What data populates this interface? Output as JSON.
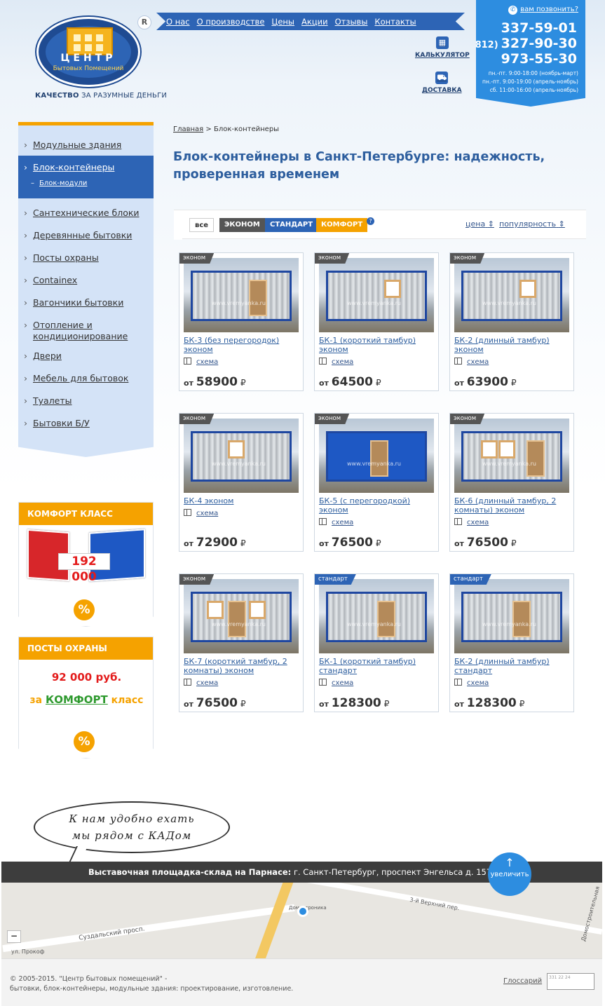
{
  "header": {
    "logo_title": "ЦЕНТР",
    "logo_subtitle": "Бытовых Помещений",
    "registered": "R",
    "tagline_bold": "КАЧЕСТВО",
    "tagline_rest": " ЗА РАЗУМНЫЕ ДЕНЬГИ",
    "nav": [
      "О нас",
      "О производстве",
      "Цены",
      "Акции",
      "Отзывы",
      "Контакты"
    ],
    "calculator_label": "КАЛЬКУЛЯТОР",
    "delivery_label": "ДОСТАВКА",
    "callback_label": "вам позвонить?",
    "phone_1": "337-59-01",
    "phone_code": "(812)",
    "phone_2": "327-90-30",
    "phone_3": "973-55-30",
    "hours_1": "пн.-пт. 9:00-18:00 (ноябрь-март)",
    "hours_2": "пн.-пт. 9:00-19:00 (апрель-ноябрь)",
    "hours_3": "сб. 11:00-16:00 (апрель-ноябрь)"
  },
  "sidebar": {
    "items": [
      "Модульные здания",
      "Сантехнические блоки",
      "Деревянные бытовки",
      "Посты охраны",
      "Containex",
      "Вагончики бытовки",
      "Отопление и кондиционирование",
      "Двери",
      "Мебель для бытовок",
      "Туалеты",
      "Бытовки Б/У"
    ],
    "active_item": "Блок-контейнеры",
    "active_sub": "Блок-модули"
  },
  "promos": {
    "comfort_title": "КОМФОРТ КЛАСС",
    "comfort_price": "192 000",
    "posts_title": "ПОСТЫ ОХРАНЫ",
    "posts_price": "92 000 руб.",
    "posts_prefix": "за",
    "posts_highlight": "КОМФОРТ",
    "posts_suffix": "класс",
    "percent": "%"
  },
  "main": {
    "breadcrumb_home": "Главная",
    "breadcrumb_sep": " > ",
    "breadcrumb_current": "Блок-контейнеры",
    "title": "Блок-контейнеры в Санкт-Петербурге: надежность, проверенная временем",
    "filters": {
      "all": "все",
      "eco": "ЭКОНОМ",
      "std": "СТАНДАРТ",
      "com": "КОМФОРТ",
      "help": "?",
      "sort_price": "цена",
      "sort_pop": "популярность"
    }
  },
  "products": [
    {
      "tag": "эконом",
      "tag_type": "eco",
      "name": "БК-3 (без перегородок) эконом",
      "scheme": "схема",
      "price_prefix": "от",
      "price": "58900",
      "currency": "₽"
    },
    {
      "tag": "эконом",
      "tag_type": "eco",
      "name": "БК-1 (короткий тамбур) эконом",
      "scheme": "схема",
      "price_prefix": "от",
      "price": "64500",
      "currency": "₽"
    },
    {
      "tag": "эконом",
      "tag_type": "eco",
      "name": "БК-2 (длинный тамбур) эконом",
      "scheme": "схема",
      "price_prefix": "от",
      "price": "63900",
      "currency": "₽"
    },
    {
      "tag": "эконом",
      "tag_type": "eco",
      "name": "БК-4 эконом",
      "scheme": "схема",
      "price_prefix": "от",
      "price": "72900",
      "currency": "₽"
    },
    {
      "tag": "эконом",
      "tag_type": "eco",
      "name": "БК-5 (с перегородкой) эконом",
      "scheme": "схема",
      "price_prefix": "от",
      "price": "76500",
      "currency": "₽"
    },
    {
      "tag": "эконом",
      "tag_type": "eco",
      "name": "БК-6 (длинный тамбур, 2 комнаты) эконом",
      "scheme": "схема",
      "price_prefix": "от",
      "price": "76500",
      "currency": "₽"
    },
    {
      "tag": "эконом",
      "tag_type": "eco",
      "name": "БК-7 (короткий тамбур, 2 комнаты) эконом",
      "scheme": "схема",
      "price_prefix": "от",
      "price": "76500",
      "currency": "₽"
    },
    {
      "tag": "стандарт",
      "tag_type": "std",
      "name": "БК-1 (короткий тамбур) стандарт",
      "scheme": "схема",
      "price_prefix": "от",
      "price": "128300",
      "currency": "₽"
    },
    {
      "tag": "стандарт",
      "tag_type": "std",
      "name": "БК-2 (длинный тамбур) стандарт",
      "scheme": "схема",
      "price_prefix": "от",
      "price": "128300",
      "currency": "₽"
    }
  ],
  "watermark": "www.vremyanka.ru",
  "bubble": {
    "line1": "К нам удобно ехать",
    "line2": "мы рядом с КАДом"
  },
  "address": {
    "label": "Выставочная площадка-склад на Парнасе:",
    "text": " г. Санкт-Петербург, проспект Энгельса д. 157",
    "zoom": "увеличить"
  },
  "map": {
    "street_1": "Суздальский просп.",
    "street_2": "3-й Верхний пер.",
    "street_3": "Домостроительная",
    "place": "Домостроника",
    "street_4": "ул. Прокоф",
    "zoom_out": "−"
  },
  "footer": {
    "copyright": "© 2005-2015. \"Центр бытовых помещений\" -",
    "desc": "бытовки, блок-контейнеры, модульные здания: проектирование, изготовление.",
    "glossary": "Глоссарий",
    "counter": "331 22 24"
  }
}
